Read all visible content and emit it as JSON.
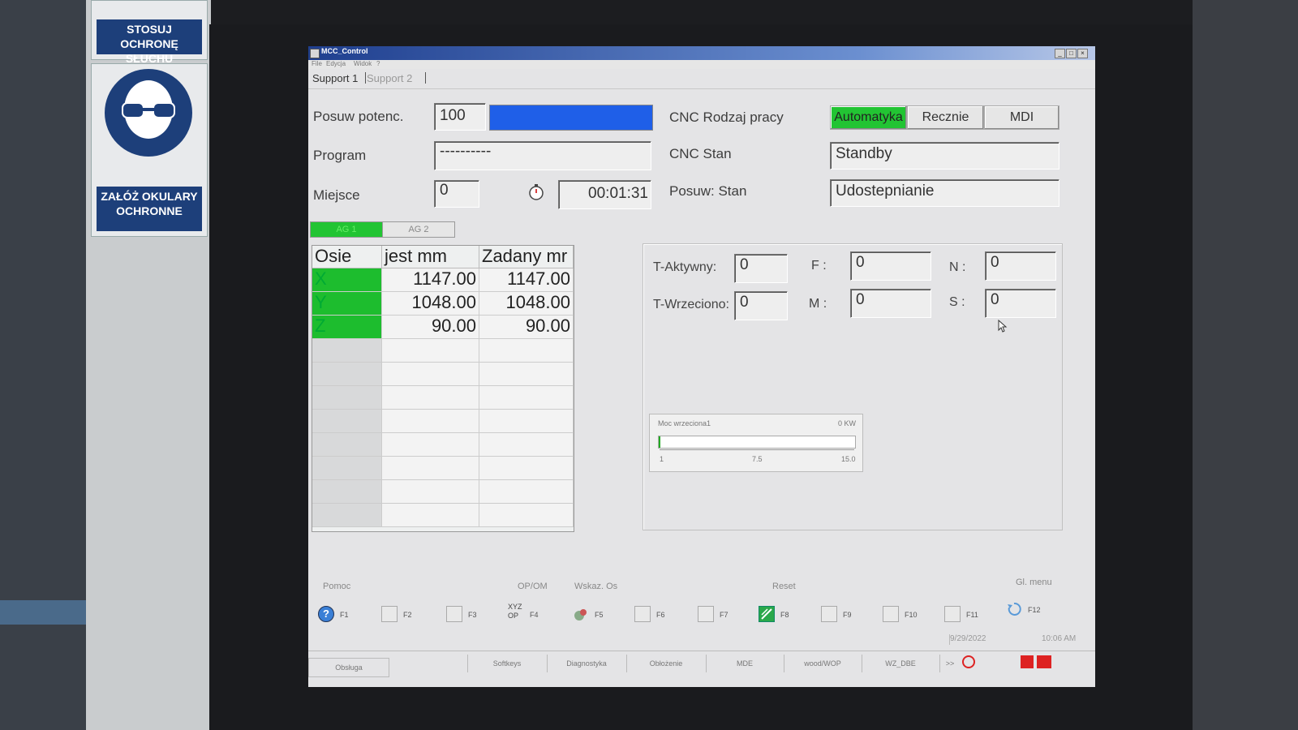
{
  "signs": {
    "hearing_caption": "STOSUJ OCHRONĘ SŁUCHU",
    "goggles_caption": "ZAŁÓŻ OKULARY OCHRONNE"
  },
  "window": {
    "title": "MCC_Control",
    "menu": [
      "File",
      "Edycja",
      "Widok",
      "?"
    ]
  },
  "tabs": [
    "Support 1",
    "Support 2"
  ],
  "feed": {
    "label": "Posuw potenc.",
    "value": "100",
    "bar_fill": 1.0
  },
  "program": {
    "label": "Program",
    "value": "----------"
  },
  "location": {
    "label": "Miejsce",
    "value": "0",
    "timer": "00:01:31"
  },
  "cnc_mode": {
    "label": "CNC Rodzaj pracy",
    "buttons": [
      "Automatyka",
      "Recznie",
      "MDI"
    ],
    "active": "Automatyka"
  },
  "cnc_state": {
    "label": "CNC Stan",
    "value": "Standby"
  },
  "feed_state": {
    "label": "Posuw: Stan",
    "value": "Udostepnianie"
  },
  "ag_tabs": [
    "AG 1",
    "AG 2"
  ],
  "axes": {
    "headers": [
      "Osie",
      "jest mm",
      "Zadany mr"
    ],
    "rows": [
      {
        "axis": "X",
        "actual": "1147.00",
        "target": "1147.00"
      },
      {
        "axis": "Y",
        "actual": "1048.00",
        "target": "1048.00"
      },
      {
        "axis": "Z",
        "actual": "90.00",
        "target": "90.00"
      }
    ]
  },
  "tool_params": {
    "t_active": {
      "label": "T-Aktywny:",
      "value": "0"
    },
    "t_spindle": {
      "label": "T-Wrzeciono:",
      "value": "0"
    },
    "f": {
      "label": "F :",
      "value": "0"
    },
    "m": {
      "label": "M :",
      "value": "0"
    },
    "n": {
      "label": "N :",
      "value": "0"
    },
    "s": {
      "label": "S :",
      "value": "0"
    }
  },
  "power": {
    "label": "Moc wrzeciona1",
    "value": "0 KW",
    "ticks": [
      "1",
      "7.5",
      "15.0"
    ]
  },
  "softkey_labels": {
    "help": "Pomoc",
    "opom": "OP/OM",
    "wskaz": "Wskaz. Os",
    "reset": "Reset",
    "gl_menu": "Gl. menu"
  },
  "fkeys": [
    "F1",
    "F2",
    "F3",
    "F4",
    "F5",
    "F6",
    "F7",
    "F8",
    "F9",
    "F10",
    "F11",
    "F12"
  ],
  "f4_text": "XYZ OP",
  "status": {
    "date": "9/29/2022",
    "time": "10:06 AM"
  },
  "bottom_tabs": [
    "Obsługa",
    "",
    "Softkeys",
    "Diagnostyka",
    "Obłożenie",
    "MDE",
    "wood/WOP",
    "WZ_DBE",
    ">>"
  ]
}
